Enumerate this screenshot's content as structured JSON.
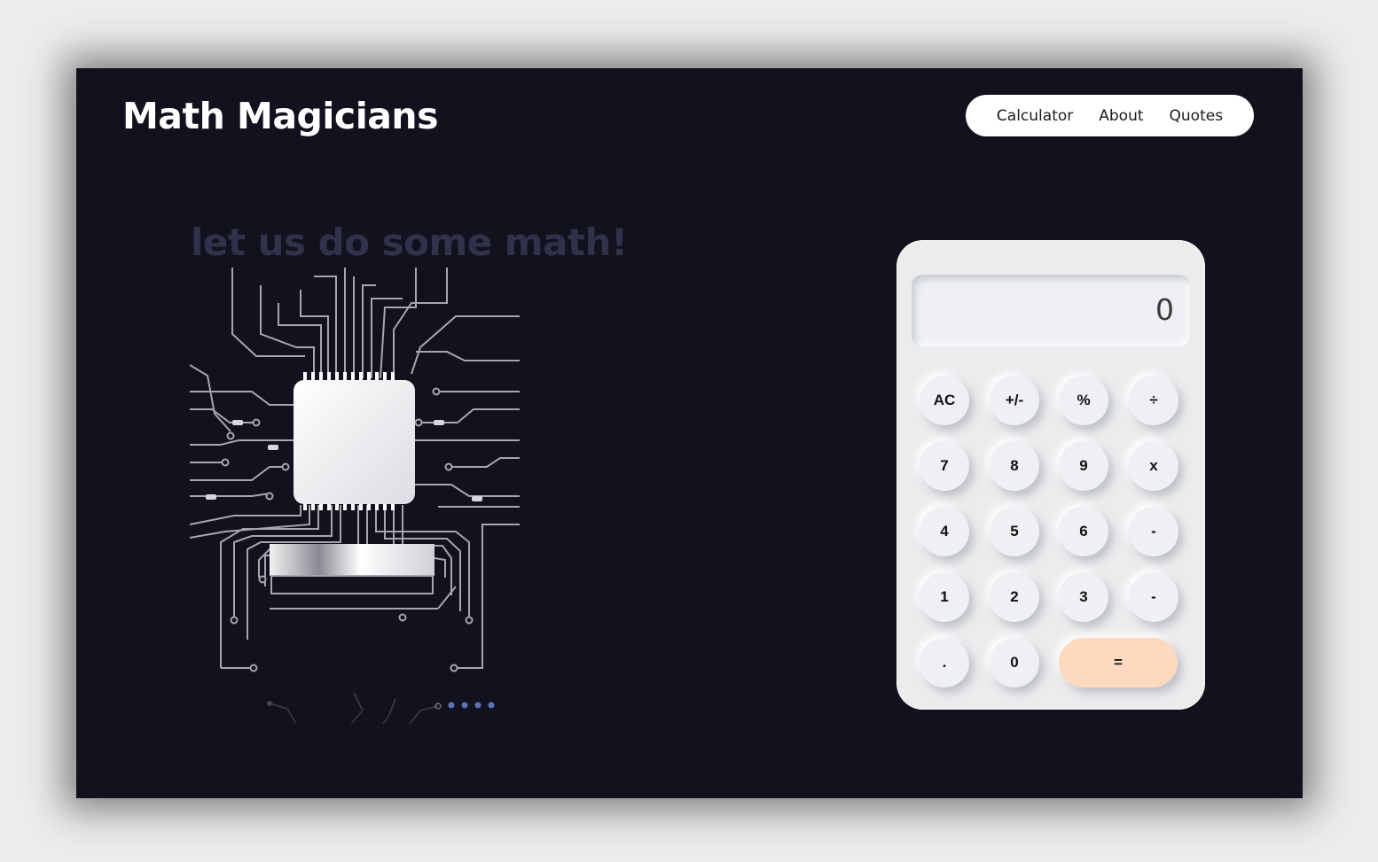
{
  "header": {
    "title": "Math Magicians"
  },
  "nav": {
    "items": [
      {
        "label": "Calculator"
      },
      {
        "label": "About"
      },
      {
        "label": "Quotes"
      }
    ]
  },
  "hero": {
    "tagline": "let us do some math!",
    "image_icon": "circuit-chip-illustration"
  },
  "calculator": {
    "display_value": "0",
    "accent_color": "#fdd9bf",
    "keys": [
      {
        "label": "AC"
      },
      {
        "label": "+/-"
      },
      {
        "label": "%"
      },
      {
        "label": "÷"
      },
      {
        "label": "7"
      },
      {
        "label": "8"
      },
      {
        "label": "9"
      },
      {
        "label": "x"
      },
      {
        "label": "4"
      },
      {
        "label": "5"
      },
      {
        "label": "6"
      },
      {
        "label": "-"
      },
      {
        "label": "1"
      },
      {
        "label": "2"
      },
      {
        "label": "3"
      },
      {
        "label": "-"
      },
      {
        "label": "."
      },
      {
        "label": "0"
      },
      {
        "label": "="
      }
    ]
  },
  "colors": {
    "page_background": "#12121e",
    "title_text": "#ffffff",
    "tagline_text": "#30324b",
    "nav_background": "#ffffff",
    "calculator_body": "#ececed"
  }
}
